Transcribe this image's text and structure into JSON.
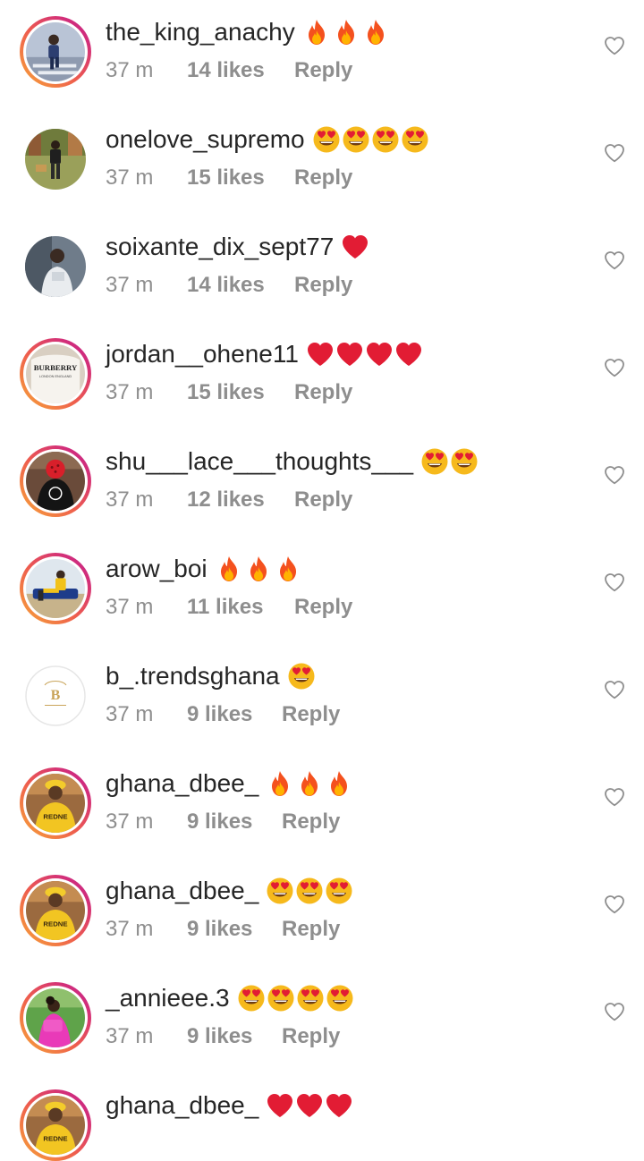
{
  "comments": [
    {
      "username": "the_king_anachy",
      "emojis": [
        "fire",
        "fire",
        "fire"
      ],
      "time": "37 m",
      "likes": "14 likes",
      "reply": "Reply",
      "ring": true,
      "avatar": "person-stairs"
    },
    {
      "username": "onelove_supremo",
      "emojis": [
        "heart-eyes",
        "heart-eyes",
        "heart-eyes",
        "heart-eyes"
      ],
      "time": "37 m",
      "likes": "15 likes",
      "reply": "Reply",
      "ring": false,
      "avatar": "person-yard"
    },
    {
      "username": "soixante_dix_sept77",
      "emojis": [
        "red-heart"
      ],
      "time": "37 m",
      "likes": "14 likes",
      "reply": "Reply",
      "ring": false,
      "avatar": "person-gray"
    },
    {
      "username": "jordan__ohene11",
      "emojis": [
        "red-heart",
        "red-heart",
        "red-heart",
        "red-heart"
      ],
      "time": "37 m",
      "likes": "15 likes",
      "reply": "Reply",
      "ring": true,
      "avatar": "burberry-shirt"
    },
    {
      "username": "shu___lace___thoughts___",
      "emojis": [
        "heart-eyes",
        "heart-eyes"
      ],
      "time": "37 m",
      "likes": "12 likes",
      "reply": "Reply",
      "ring": true,
      "avatar": "person-red-mask"
    },
    {
      "username": "arow_boi",
      "emojis": [
        "fire",
        "fire",
        "fire"
      ],
      "time": "37 m",
      "likes": "11 likes",
      "reply": "Reply",
      "ring": true,
      "avatar": "person-sitting"
    },
    {
      "username": "b_.trendsghana",
      "emojis": [
        "heart-eyes"
      ],
      "time": "37 m",
      "likes": "9 likes",
      "reply": "Reply",
      "ring": false,
      "avatar": "logo-b",
      "logo_letter": "B"
    },
    {
      "username": "ghana_dbee_",
      "emojis": [
        "fire",
        "fire",
        "fire"
      ],
      "time": "37 m",
      "likes": "9 likes",
      "reply": "Reply",
      "ring": true,
      "avatar": "person-yellow-shirt"
    },
    {
      "username": "ghana_dbee_",
      "emojis": [
        "heart-eyes",
        "heart-eyes",
        "heart-eyes"
      ],
      "time": "37 m",
      "likes": "9 likes",
      "reply": "Reply",
      "ring": true,
      "avatar": "person-yellow-shirt"
    },
    {
      "username": "_annieee.3",
      "emojis": [
        "heart-eyes",
        "heart-eyes",
        "heart-eyes",
        "heart-eyes"
      ],
      "time": "37 m",
      "likes": "9 likes",
      "reply": "Reply",
      "ring": true,
      "avatar": "person-pink"
    },
    {
      "username": "ghana_dbee_",
      "emojis": [
        "red-heart",
        "red-heart",
        "red-heart"
      ],
      "time": "",
      "likes": "",
      "reply": "",
      "ring": true,
      "avatar": "person-yellow-shirt"
    }
  ],
  "icons": {
    "like": "heart-outline-icon"
  },
  "colors": {
    "text": "#262626",
    "meta": "#8e8e8e",
    "ring_start": "#f7a738",
    "ring_end": "#c2258f"
  }
}
